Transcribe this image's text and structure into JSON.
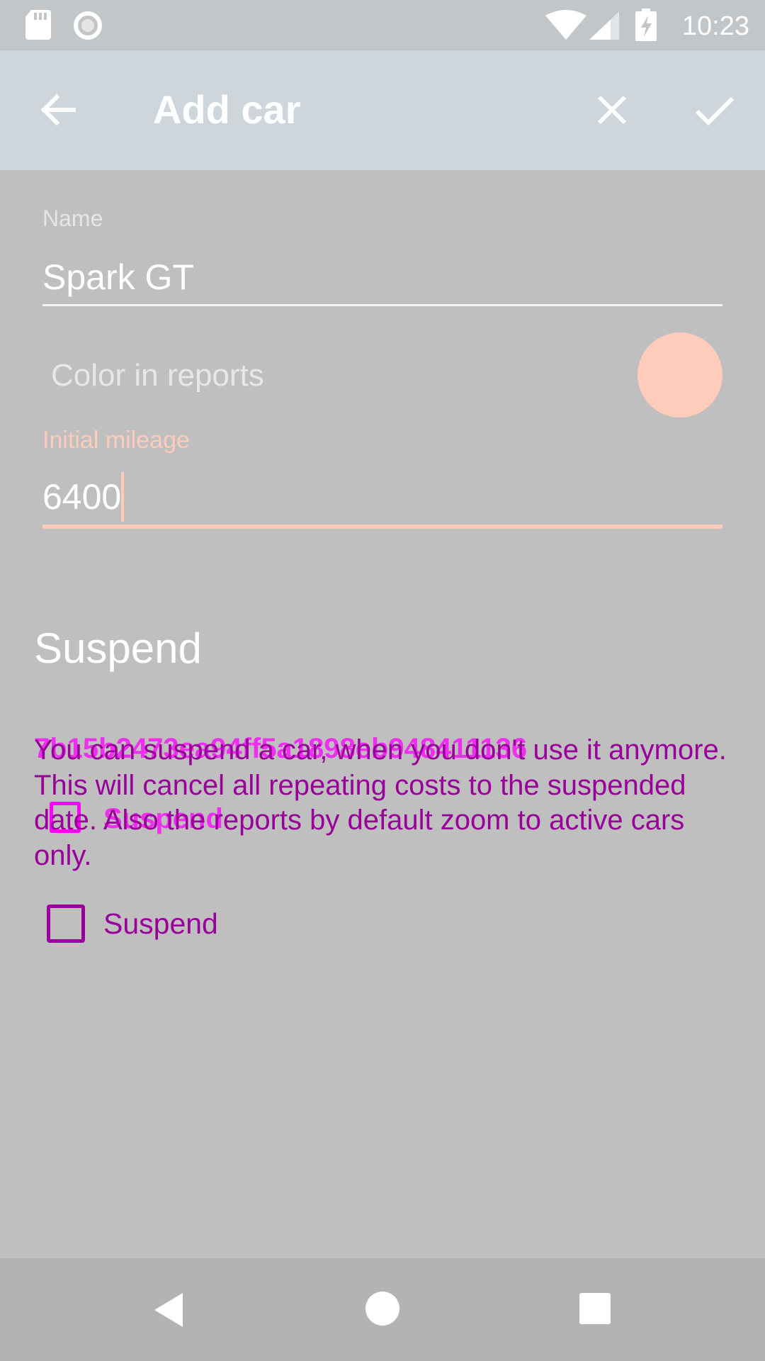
{
  "status_bar": {
    "time": "10:23",
    "icons": [
      "sd-card-icon",
      "circle-icon",
      "wifi-icon",
      "cellular-signal-icon",
      "battery-charging-icon"
    ]
  },
  "app_bar": {
    "title": "Add car",
    "back_icon": "arrow-left-icon",
    "close_icon": "close-icon",
    "confirm_icon": "check-icon"
  },
  "form": {
    "name_label": "Name",
    "name_value": "Spark GT",
    "color_label": "Color in reports",
    "color_value": "#ffccbc",
    "mileage_label": "Initial mileage",
    "mileage_value": "6400"
  },
  "suspend": {
    "heading": "Suspend",
    "description": "You can suspend a car, when you don't use it anymore. This will cancel all repeating costs to the suspended date. Also the reports by default zoom to active cars only.",
    "checkbox_label": "Suspend",
    "checked": false
  },
  "overlay": {
    "id_text": "7b15b2473ea94ff5a1898eb948411136",
    "checkbox_label": "Suspend"
  },
  "colors": {
    "accent": "#ffccbc",
    "app_bar": "#cfd6db",
    "status_bar": "#c3c6c9",
    "background": "#bfbfbf",
    "overlay_text": "#990099",
    "overlay_highlight": "#ff00ff"
  },
  "nav_bar": {
    "icons": [
      "nav-back-icon",
      "nav-home-icon",
      "nav-recents-icon"
    ]
  }
}
